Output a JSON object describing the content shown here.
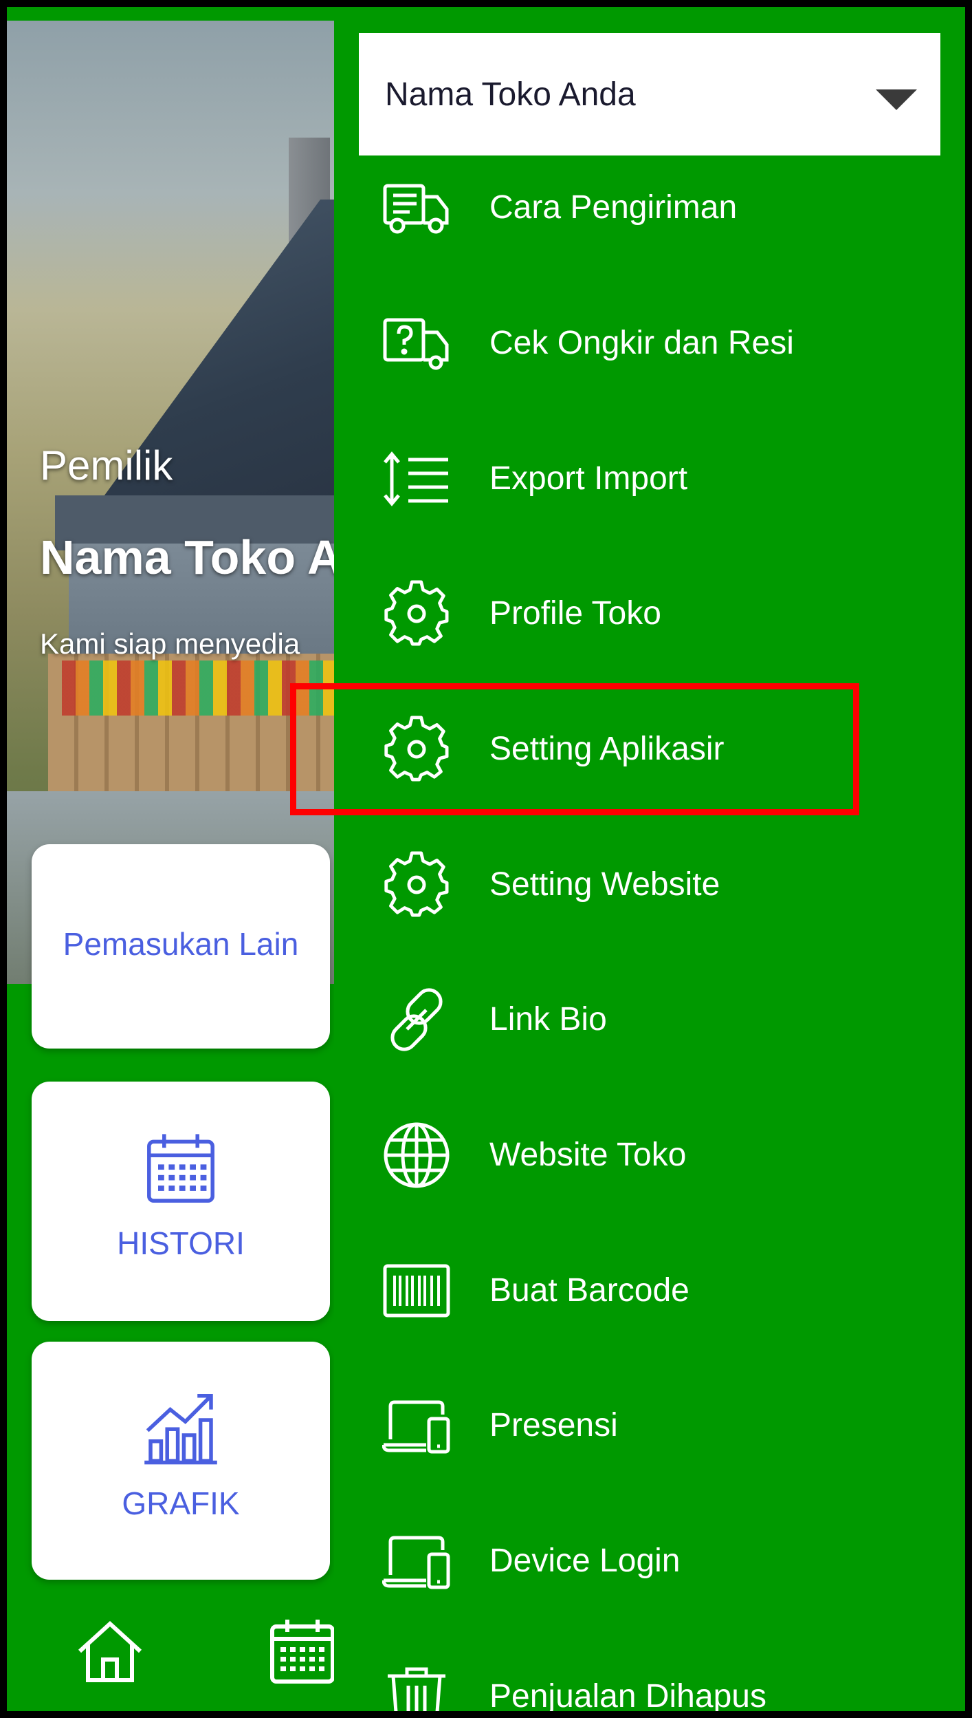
{
  "colors": {
    "drawer_bg": "#009900",
    "card_text": "#4a5fe0",
    "highlight": "#ff0000",
    "select_bg": "#ffffff"
  },
  "background": {
    "hero": {
      "role": "Pemilik",
      "shop_name": "Nama Toko A",
      "tagline": "Kami siap menyedia"
    },
    "cards": {
      "income_label": "Pemasukan Lain",
      "history_label": "HISTORI",
      "history_icon": "calendar-icon",
      "chart_label": "GRAFIK",
      "chart_icon": "bar-chart-trend-icon"
    },
    "bottom_nav": {
      "home_icon": "home-icon",
      "calendar_icon": "calendar-icon"
    }
  },
  "drawer": {
    "store_select": {
      "label": "Nama Toko Anda",
      "icon": "caret-down-icon"
    },
    "menu": [
      {
        "label": "Cara Pengiriman",
        "icon": "delivery-truck-icon"
      },
      {
        "label": "Cek Ongkir dan Resi",
        "icon": "truck-question-icon"
      },
      {
        "label": "Export Import",
        "icon": "sort-lines-icon"
      },
      {
        "label": "Profile Toko",
        "icon": "gear-icon"
      },
      {
        "label": "Setting Aplikasir",
        "icon": "gear-icon",
        "highlighted": true
      },
      {
        "label": "Setting Website",
        "icon": "gear-icon"
      },
      {
        "label": "Link Bio",
        "icon": "link-icon"
      },
      {
        "label": "Website Toko",
        "icon": "globe-icon"
      },
      {
        "label": "Buat Barcode",
        "icon": "barcode-icon"
      },
      {
        "label": "Presensi",
        "icon": "devices-icon"
      },
      {
        "label": "Device Login",
        "icon": "devices-icon"
      },
      {
        "label": "Penjualan Dihapus",
        "icon": "trash-icon"
      }
    ]
  }
}
